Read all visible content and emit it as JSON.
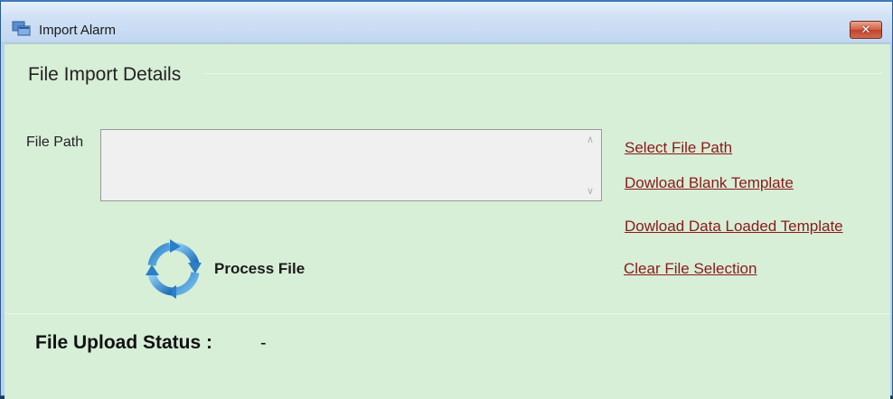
{
  "window": {
    "title": "Import Alarm",
    "close_label": "✕"
  },
  "section": {
    "title": "File Import Details"
  },
  "file_path": {
    "label": "File Path",
    "value": ""
  },
  "links": {
    "select_file_path": "Select File Path",
    "download_blank_template": "Dowload Blank Template",
    "download_data_loaded_template": "Dowload Data Loaded Template",
    "clear_file_selection": "Clear File Selection"
  },
  "process": {
    "label": "Process File",
    "icon": "refresh-icon"
  },
  "status": {
    "label": "File Upload Status :",
    "value": "-"
  },
  "colors": {
    "link": "#8b1a1a",
    "panel_background": "#d7eed7",
    "close_button": "#c1412b"
  }
}
